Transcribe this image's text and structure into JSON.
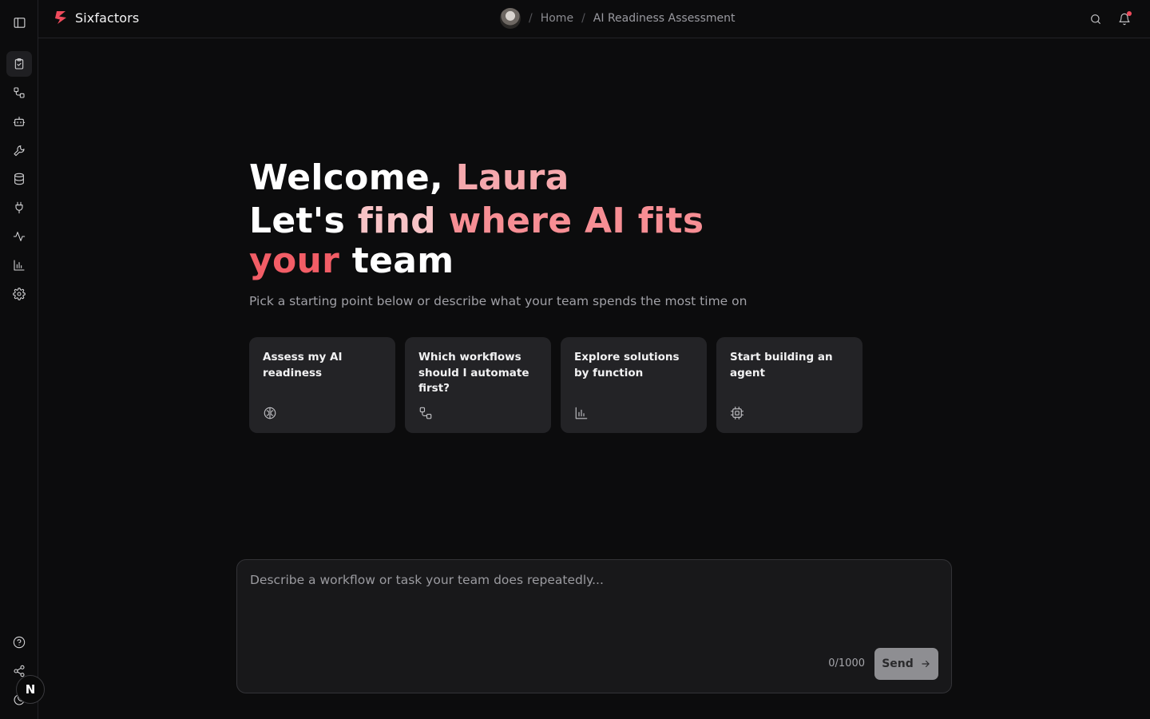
{
  "app": {
    "name": "Sixfactors",
    "brand_color": "#ef4b5c"
  },
  "breadcrumb": {
    "home": "Home",
    "separator": "/",
    "current": "AI Readiness Assessment"
  },
  "sidebar": {
    "items": [
      {
        "name": "clipboard-check-icon",
        "active": true
      },
      {
        "name": "workflow-icon"
      },
      {
        "name": "bot-icon"
      },
      {
        "name": "wrench-icon"
      },
      {
        "name": "database-icon"
      },
      {
        "name": "plug-icon"
      },
      {
        "name": "activity-icon"
      },
      {
        "name": "bar-chart-icon"
      },
      {
        "name": "settings-icon"
      }
    ],
    "bottom": [
      {
        "name": "help-circle-icon"
      },
      {
        "name": "share-icon"
      },
      {
        "name": "moon-icon"
      }
    ],
    "user_initial": "N"
  },
  "hero": {
    "welcome_prefix": "Welcome, ",
    "user_name": "Laura",
    "headline_1": "Let's ",
    "headline_2": "find ",
    "headline_3": "where AI ",
    "headline_4": "fits ",
    "headline_5": "your",
    "headline_6": "team",
    "subtitle": "Pick a starting point below or describe what your team spends the most time on"
  },
  "cards": [
    {
      "title": "Assess my AI readiness",
      "icon": "brain-icon"
    },
    {
      "title": "Which workflows should I automate first?",
      "icon": "workflow-icon"
    },
    {
      "title": "Explore solutions by function",
      "icon": "bar-chart-icon"
    },
    {
      "title": "Start building an agent",
      "icon": "cpu-icon"
    }
  ],
  "composer": {
    "placeholder": "Describe a workflow or task your team does repeatedly...",
    "value": "",
    "counter": "0/1000",
    "send_label": "Send"
  }
}
